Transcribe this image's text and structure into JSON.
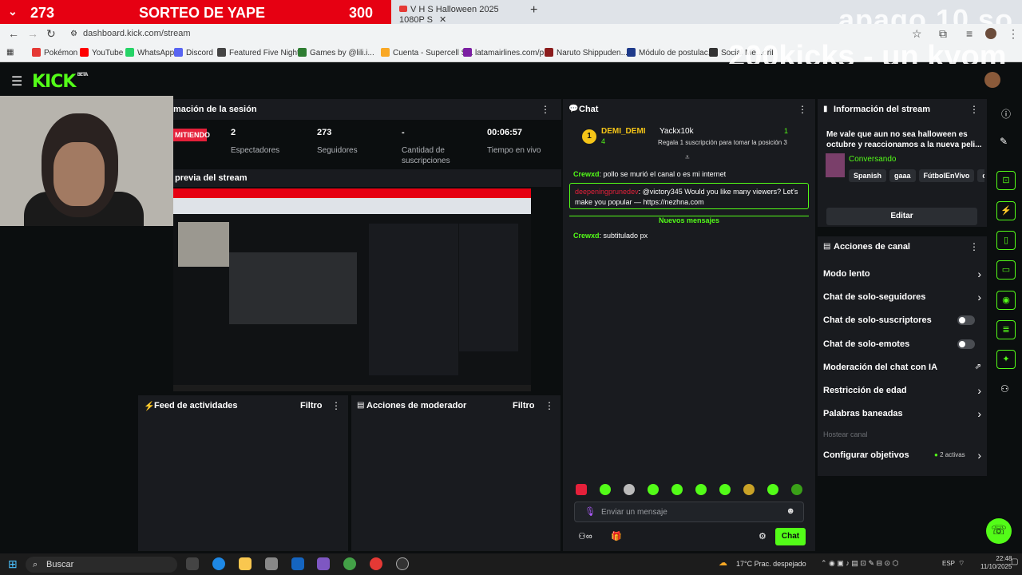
{
  "browser": {
    "red_tab": {
      "left_count": "273",
      "title": "SORTEO DE YAPE",
      "right_count": "300"
    },
    "tab2_title": "V H S Halloween 2025 1080P S",
    "url": "dashboard.kick.com/stream",
    "watermark_1": "apago 10 so",
    "watermark_2": "200kicks - un kyom",
    "bookmarks": [
      {
        "label": "Pokémon",
        "color": "#e53935"
      },
      {
        "label": "YouTube",
        "color": "#ff0000"
      },
      {
        "label": "WhatsApp",
        "color": "#25d366"
      },
      {
        "label": "Discord",
        "color": "#5865f2"
      },
      {
        "label": "Featured Five Night...",
        "color": "#444444"
      },
      {
        "label": "Games by @lili.i...",
        "color": "#2e7d32"
      },
      {
        "label": "Cuenta - Supercell S...",
        "color": "#f9a825"
      },
      {
        "label": "latamairlines.com/p...",
        "color": "#7b1fa2"
      },
      {
        "label": "Naruto Shippuden...",
        "color": "#8b1c1c"
      },
      {
        "label": "Módulo de postulac...",
        "color": "#1e3a8a"
      },
      {
        "label": "Social Me...oril",
        "color": "#333333"
      }
    ]
  },
  "kick": {
    "logo": "KICK",
    "logo_badge": "BETA"
  },
  "session": {
    "title": "mación de la sesión",
    "live_label": "MITIENDO",
    "stats": [
      {
        "value": "2",
        "label": "Espectadores"
      },
      {
        "value": "273",
        "label": "Seguidores"
      },
      {
        "value": "-",
        "label": "Cantidad de suscripciones"
      },
      {
        "value": "00:06:57",
        "label": "Tiempo en vivo"
      }
    ],
    "preview_title": "previa del stream"
  },
  "feed": {
    "title": "Feed de actividades",
    "filter": "Filtro"
  },
  "mod": {
    "title": "Acciones de moderador",
    "filter": "Filtro"
  },
  "chat": {
    "title": "Chat",
    "top_user": "DEMI_DEMI",
    "top_user_count": "4",
    "top_rank": "1",
    "second_user": "Yackx10k",
    "second_count": "1",
    "goal_text": "Regala 1 suscripción para tomar la posición 3",
    "messages": [
      {
        "user": "Crewxd",
        "text": "pollo se murió el canal o es mi internet"
      },
      {
        "user": "deepeningprunedev",
        "text": "@victory345 Would you like many viewers? Let's make you popular — https://nezhna.com"
      }
    ],
    "new_messages": "Nuevos mensajes",
    "after": {
      "user": "Crewxd",
      "text": "subtitulado px"
    },
    "input_placeholder": "Enviar un mensaje",
    "send_label": "Chat"
  },
  "stream_info": {
    "title": "Información del stream",
    "headline": "Me vale que aun no sea halloween es octubre y reaccionamos a la nueva peli...",
    "category": "Conversando",
    "tags": [
      "Spanish",
      "gaaa",
      "FútbolEnVivo",
      "ca"
    ],
    "edit_label": "Editar"
  },
  "channel_actions": {
    "title": "Acciones de canal",
    "items": [
      {
        "label": "Modo lento",
        "control": "arrow"
      },
      {
        "label": "Chat de solo-seguidores",
        "control": "arrow"
      },
      {
        "label": "Chat de solo-suscriptores",
        "control": "toggle"
      },
      {
        "label": "Chat de solo-emotes",
        "control": "toggle"
      },
      {
        "label": "Moderación del chat con IA",
        "control": "external"
      },
      {
        "label": "Restricción de edad",
        "control": "arrow"
      },
      {
        "label": "Palabras baneadas",
        "control": "arrow"
      }
    ],
    "host_label": "Hostear canal",
    "goals_label": "Configurar objetivos",
    "goals_active": "2 activas"
  },
  "taskbar": {
    "search": "Buscar",
    "weather": "17°C  Prac. despejado",
    "lang": "ESP",
    "time": "22:48",
    "date": "11/10/2025"
  },
  "colors": {
    "accent": "#53fc18",
    "live": "#e5203a",
    "panel": "#191b1f",
    "bg": "#0b0e0f"
  }
}
